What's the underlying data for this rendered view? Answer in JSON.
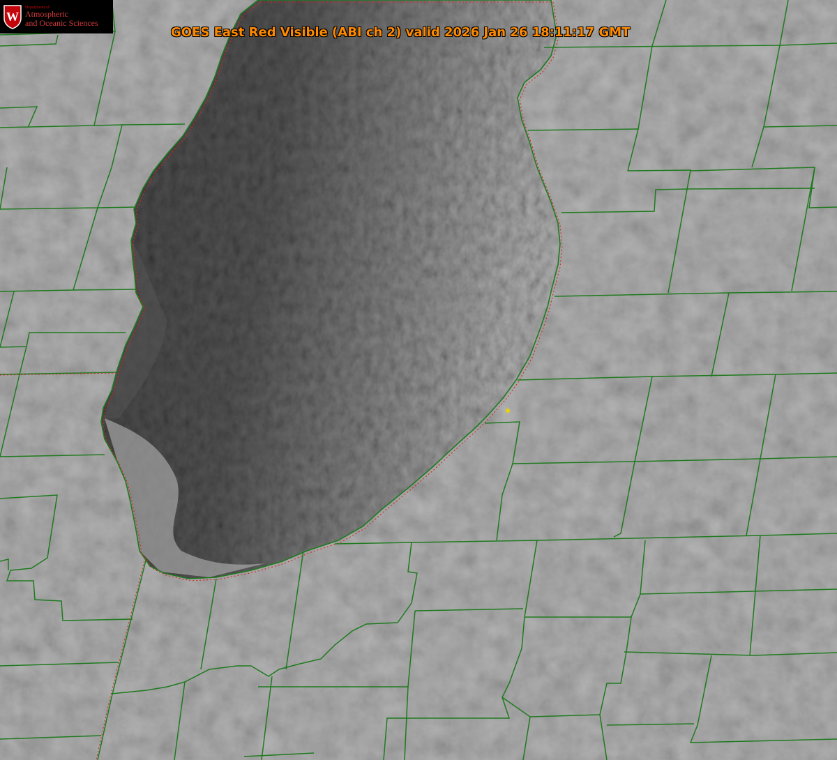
{
  "title": "GOES East Red Visible (ABI ch 2) valid 2026 Jan 26 18:11:17 GMT",
  "logo": {
    "department": "Department of",
    "line1": "Atmospheric",
    "line2": "and Oceanic Sciences",
    "seal_letter": "W"
  },
  "map": {
    "imagery": "grayscale visible satellite",
    "water_body": "lake",
    "county_line_color": "#1f7a1f",
    "shore_dotted_color": "#e02020",
    "marker_color": "#e8d400"
  }
}
